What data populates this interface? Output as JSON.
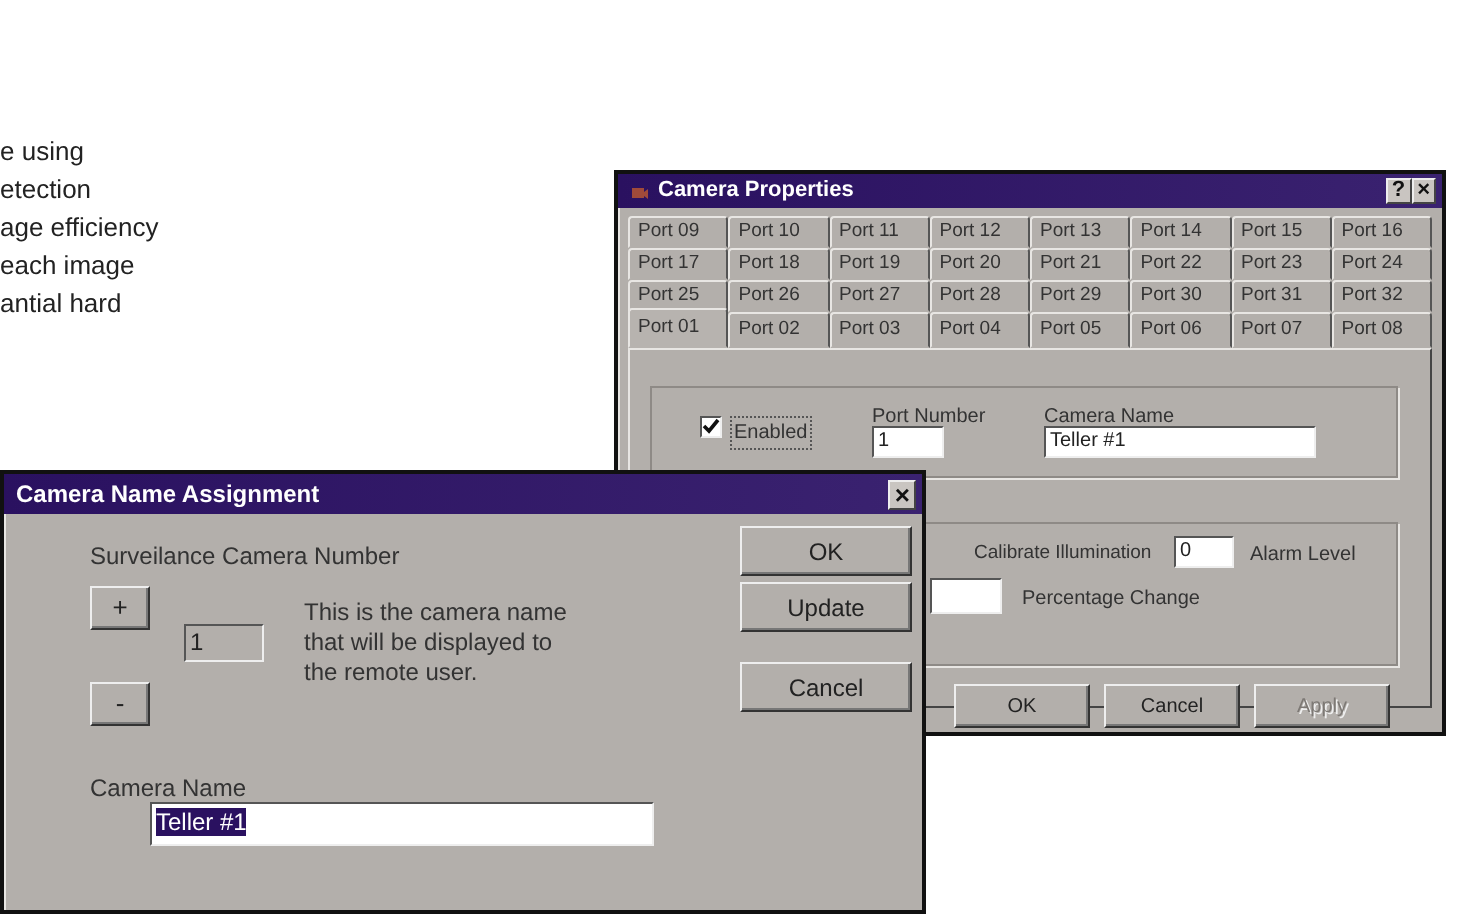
{
  "side_text": [
    "e using",
    "etection",
    "age efficiency",
    "each image",
    "antial hard"
  ],
  "properties_window": {
    "title": "Camera Properties",
    "help_button": "?",
    "close_button": "×",
    "tab_rows": [
      [
        {
          "label": "Port 09",
          "selected": false
        },
        {
          "label": "Port 10",
          "selected": false
        },
        {
          "label": "Port 11",
          "selected": false
        },
        {
          "label": "Port 12",
          "selected": false
        },
        {
          "label": "Port 13",
          "selected": false
        },
        {
          "label": "Port 14",
          "selected": false
        },
        {
          "label": "Port 15",
          "selected": false
        },
        {
          "label": "Port 16",
          "selected": false
        }
      ],
      [
        {
          "label": "Port 17",
          "selected": false
        },
        {
          "label": "Port 18",
          "selected": false
        },
        {
          "label": "Port 19",
          "selected": false
        },
        {
          "label": "Port 20",
          "selected": false
        },
        {
          "label": "Port 21",
          "selected": false
        },
        {
          "label": "Port 22",
          "selected": false
        },
        {
          "label": "Port 23",
          "selected": false
        },
        {
          "label": "Port 24",
          "selected": false
        }
      ],
      [
        {
          "label": "Port 25",
          "selected": false
        },
        {
          "label": "Port 26",
          "selected": false
        },
        {
          "label": "Port 27",
          "selected": false
        },
        {
          "label": "Port 28",
          "selected": false
        },
        {
          "label": "Port 29",
          "selected": false
        },
        {
          "label": "Port 30",
          "selected": false
        },
        {
          "label": "Port 31",
          "selected": false
        },
        {
          "label": "Port 32",
          "selected": false
        }
      ],
      [
        {
          "label": "Port 01",
          "selected": true
        },
        {
          "label": "Port 02",
          "selected": false
        },
        {
          "label": "Port 03",
          "selected": false
        },
        {
          "label": "Port 04",
          "selected": false
        },
        {
          "label": "Port 05",
          "selected": false
        },
        {
          "label": "Port 06",
          "selected": false
        },
        {
          "label": "Port 07",
          "selected": false
        },
        {
          "label": "Port 08",
          "selected": false
        }
      ]
    ],
    "enabled": {
      "label": "Enabled",
      "checked": true
    },
    "port_number": {
      "label": "Port Number",
      "value": "1"
    },
    "camera_name": {
      "label": "Camera Name",
      "value": "Teller #1"
    },
    "calibrate_label": "Calibrate Illumination",
    "alarm_level": {
      "value": "0",
      "label": "Alarm Level"
    },
    "percentage": {
      "label": "Percentage Change"
    },
    "buttons": [
      {
        "label": "OK",
        "disabled": false
      },
      {
        "label": "Cancel",
        "disabled": false
      },
      {
        "label": "Apply",
        "disabled": true
      }
    ]
  },
  "name_dialog": {
    "title": "Camera Name Assignment",
    "close_button": "×",
    "number_label": "Surveilance Camera Number",
    "plus_button": "+",
    "minus_button": "-",
    "number_field": {
      "value": "1",
      "disabled": true
    },
    "description": "This is the camera name that will be displayed to the remote user.",
    "buttons": [
      {
        "label": "OK"
      },
      {
        "label": "Update"
      },
      {
        "label": "Cancel"
      }
    ],
    "name_label": "Camera Name",
    "name_field": {
      "value": "Teller #1",
      "selected": true
    }
  }
}
